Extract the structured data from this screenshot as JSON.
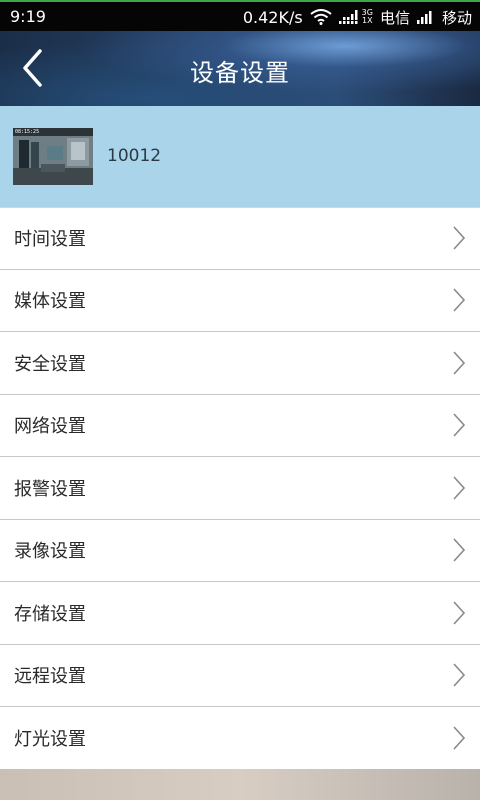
{
  "status_bar": {
    "time": "9:19",
    "speed": "0.42K/s",
    "net_type_top": "3G",
    "net_type_bottom": "1X",
    "carrier_1": "电信",
    "carrier_2": "移动",
    "icons": [
      "wifi-icon",
      "signal-icon",
      "signal-icon"
    ]
  },
  "header": {
    "title": "设备设置",
    "back_icon": "chevron-left-icon"
  },
  "device": {
    "name": "10012",
    "thumbnail_timestamp": "08:15:25"
  },
  "menu": {
    "items": [
      {
        "label": "时间设置"
      },
      {
        "label": "媒体设置"
      },
      {
        "label": "安全设置"
      },
      {
        "label": "网络设置"
      },
      {
        "label": "报警设置"
      },
      {
        "label": "录像设置"
      },
      {
        "label": "存储设置"
      },
      {
        "label": "远程设置"
      },
      {
        "label": "灯光设置"
      }
    ],
    "item_icon": "chevron-right-icon"
  },
  "colors": {
    "status_bar_bg": "#050505",
    "status_bar_accent": "#3da64a",
    "header_bg": "#243f62",
    "device_card_bg": "#a9d4ea",
    "list_bg": "#ffffff",
    "divider": "#c8c8c8"
  }
}
